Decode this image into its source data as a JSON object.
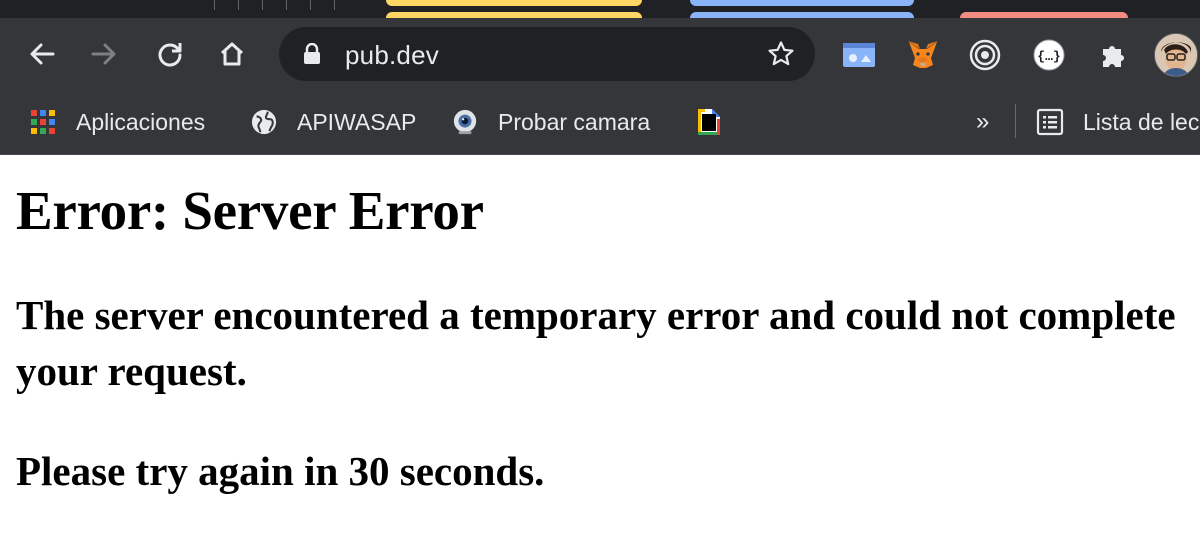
{
  "browser": {
    "url": "pub.dev",
    "colors": {
      "toolbar_bg": "#35363a",
      "omnibox_bg": "#202124",
      "text": "#e8eaed",
      "tab_yellow": "#fdd663",
      "tab_blue": "#8ab4f8",
      "tab_red": "#f28b82"
    },
    "toolbar_icons": [
      "back-arrow-icon",
      "forward-arrow-icon",
      "reload-icon",
      "home-icon",
      "lock-icon",
      "star-icon"
    ],
    "extensions": [
      "screen-extension-icon",
      "metamask-fox-icon",
      "target-extension-icon",
      "json-extension-icon",
      "puzzle-extensions-icon",
      "profile-avatar"
    ]
  },
  "bookmarks": {
    "items": [
      {
        "label": "Aplicaciones",
        "icon": "apps-grid-icon"
      },
      {
        "label": "APIWASAP",
        "icon": "globe-icon"
      },
      {
        "label": "Probar camara",
        "icon": "webcam-icon"
      },
      {
        "label": "",
        "icon": "colorful-page-icon"
      }
    ],
    "more": "»",
    "reading_list": {
      "label": "Lista de lec",
      "icon": "reading-list-icon"
    }
  },
  "page": {
    "title": "Error: Server Error",
    "message": "The server encountered a temporary error and could not complete your request.",
    "retry": "Please try again in 30 seconds."
  }
}
